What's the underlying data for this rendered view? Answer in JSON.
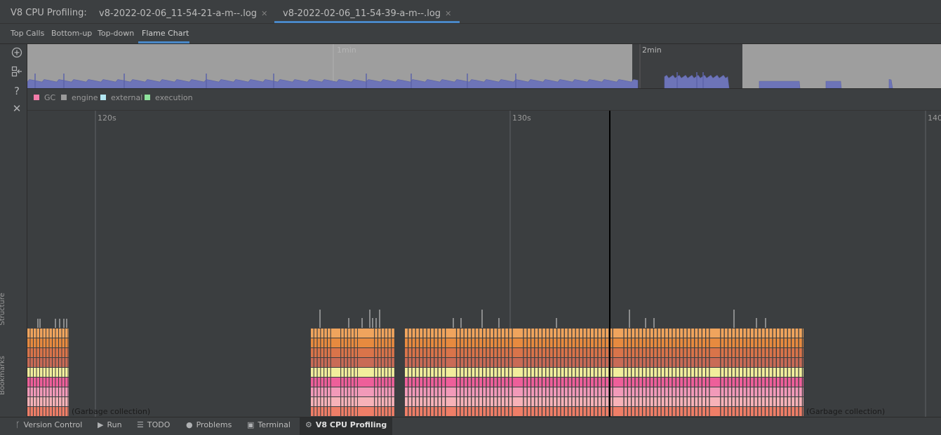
{
  "app": {
    "tool_title": "V8 CPU Profiling:",
    "file_tabs": [
      {
        "label": "v8-2022-02-06_11-54-21-a-m--.log",
        "active": false
      },
      {
        "label": "v8-2022-02-06_11-54-39-a-m--.log",
        "active": true
      }
    ],
    "view_tabs": [
      {
        "label": "Top Calls"
      },
      {
        "label": "Bottom-up"
      },
      {
        "label": "Top-down"
      },
      {
        "label": "Flame Chart",
        "active": true
      }
    ]
  },
  "sidebar": {
    "icons": [
      "zoom-in-icon",
      "navigate-icon",
      "help-icon",
      "close-icon"
    ],
    "vertical_labels": [
      "Structure",
      "Bookmarks"
    ]
  },
  "overview": {
    "tick_labels": [
      "1min",
      "2min"
    ],
    "colors": {
      "background": "#9e9e9e",
      "selection": "#3d3f41",
      "series": "#6d74b8"
    }
  },
  "legend": [
    {
      "label": "GC",
      "color": "#f37ca9"
    },
    {
      "label": "engine",
      "color": "#9a9a9a"
    },
    {
      "label": "external",
      "color": "#b2e6f2"
    },
    {
      "label": "execution",
      "color": "#8ee29c"
    }
  ],
  "flame": {
    "time_ticks": [
      "120s",
      "130s",
      "140"
    ],
    "labels": [
      "(Garbage collection)",
      "(Garbage collection)"
    ],
    "stack_colors": [
      "#f0a45d",
      "#e78a3f",
      "#d9744a",
      "#c96b56",
      "#f2ee9c",
      "#ee5f9a",
      "#f29ab9",
      "#f7b2b8",
      "#ef7e67",
      "#f4581d",
      "#9a4be3"
    ]
  },
  "statusbar": {
    "items": [
      {
        "label": "Version Control",
        "icon": "branch-icon"
      },
      {
        "label": "Run",
        "icon": "play-icon"
      },
      {
        "label": "TODO",
        "icon": "list-icon"
      },
      {
        "label": "Problems",
        "icon": "problems-icon"
      },
      {
        "label": "Terminal",
        "icon": "terminal-icon"
      },
      {
        "label": "V8 CPU Profiling",
        "icon": "profiler-icon",
        "active": true
      }
    ]
  }
}
